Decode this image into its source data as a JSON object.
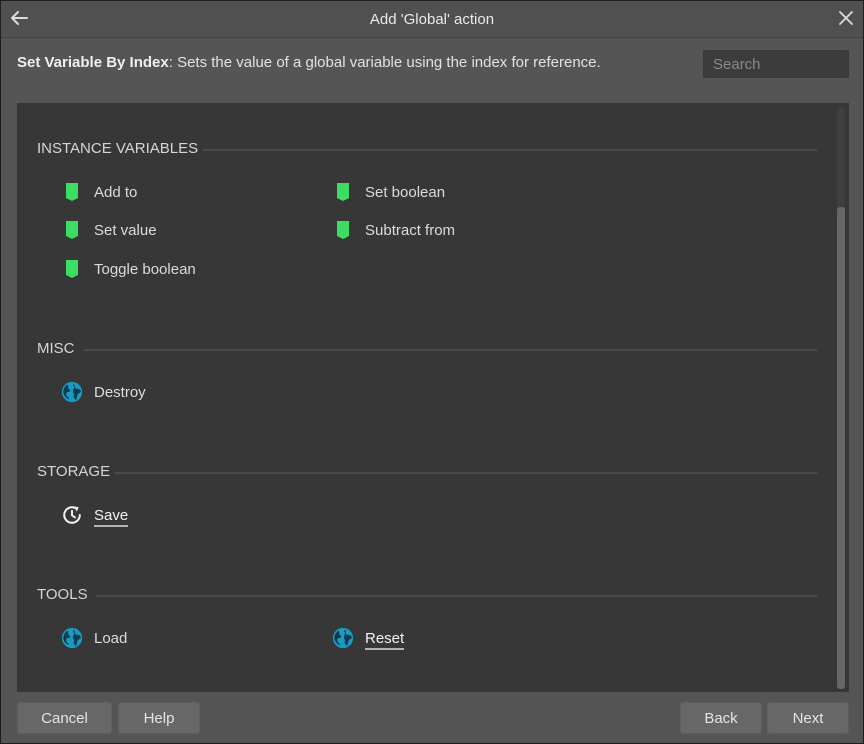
{
  "window": {
    "title": "Add 'Global' action"
  },
  "header": {
    "action_name": "Set Variable By Index",
    "action_description": ": Sets the value of a global variable using the index for reference.",
    "search_placeholder": "Search"
  },
  "sections": [
    {
      "label": "INSTANCE VARIABLES",
      "items": [
        {
          "label": "Add to",
          "icon": "bookmark-icon"
        },
        {
          "label": "Set boolean",
          "icon": "bookmark-icon"
        },
        {
          "label": "Set value",
          "icon": "bookmark-icon"
        },
        {
          "label": "Subtract from",
          "icon": "bookmark-icon"
        },
        {
          "label": "Toggle boolean",
          "icon": "bookmark-icon"
        }
      ]
    },
    {
      "label": "MISC",
      "items": [
        {
          "label": "Destroy",
          "icon": "globe-icon"
        }
      ]
    },
    {
      "label": "STORAGE",
      "items": [
        {
          "label": "Save",
          "icon": "clock-refresh-icon",
          "selected": true
        }
      ]
    },
    {
      "label": "TOOLS",
      "items": [
        {
          "label": "Load",
          "icon": "globe-icon"
        },
        {
          "label": "Reset",
          "icon": "globe-icon",
          "selected": true
        }
      ]
    }
  ],
  "footer": {
    "cancel": "Cancel",
    "help": "Help",
    "back": "Back",
    "next": "Next"
  },
  "colors": {
    "bookmark": "#3ddc63",
    "globe": "#1a9bc4",
    "panel": "#373737",
    "chrome": "#555555"
  }
}
